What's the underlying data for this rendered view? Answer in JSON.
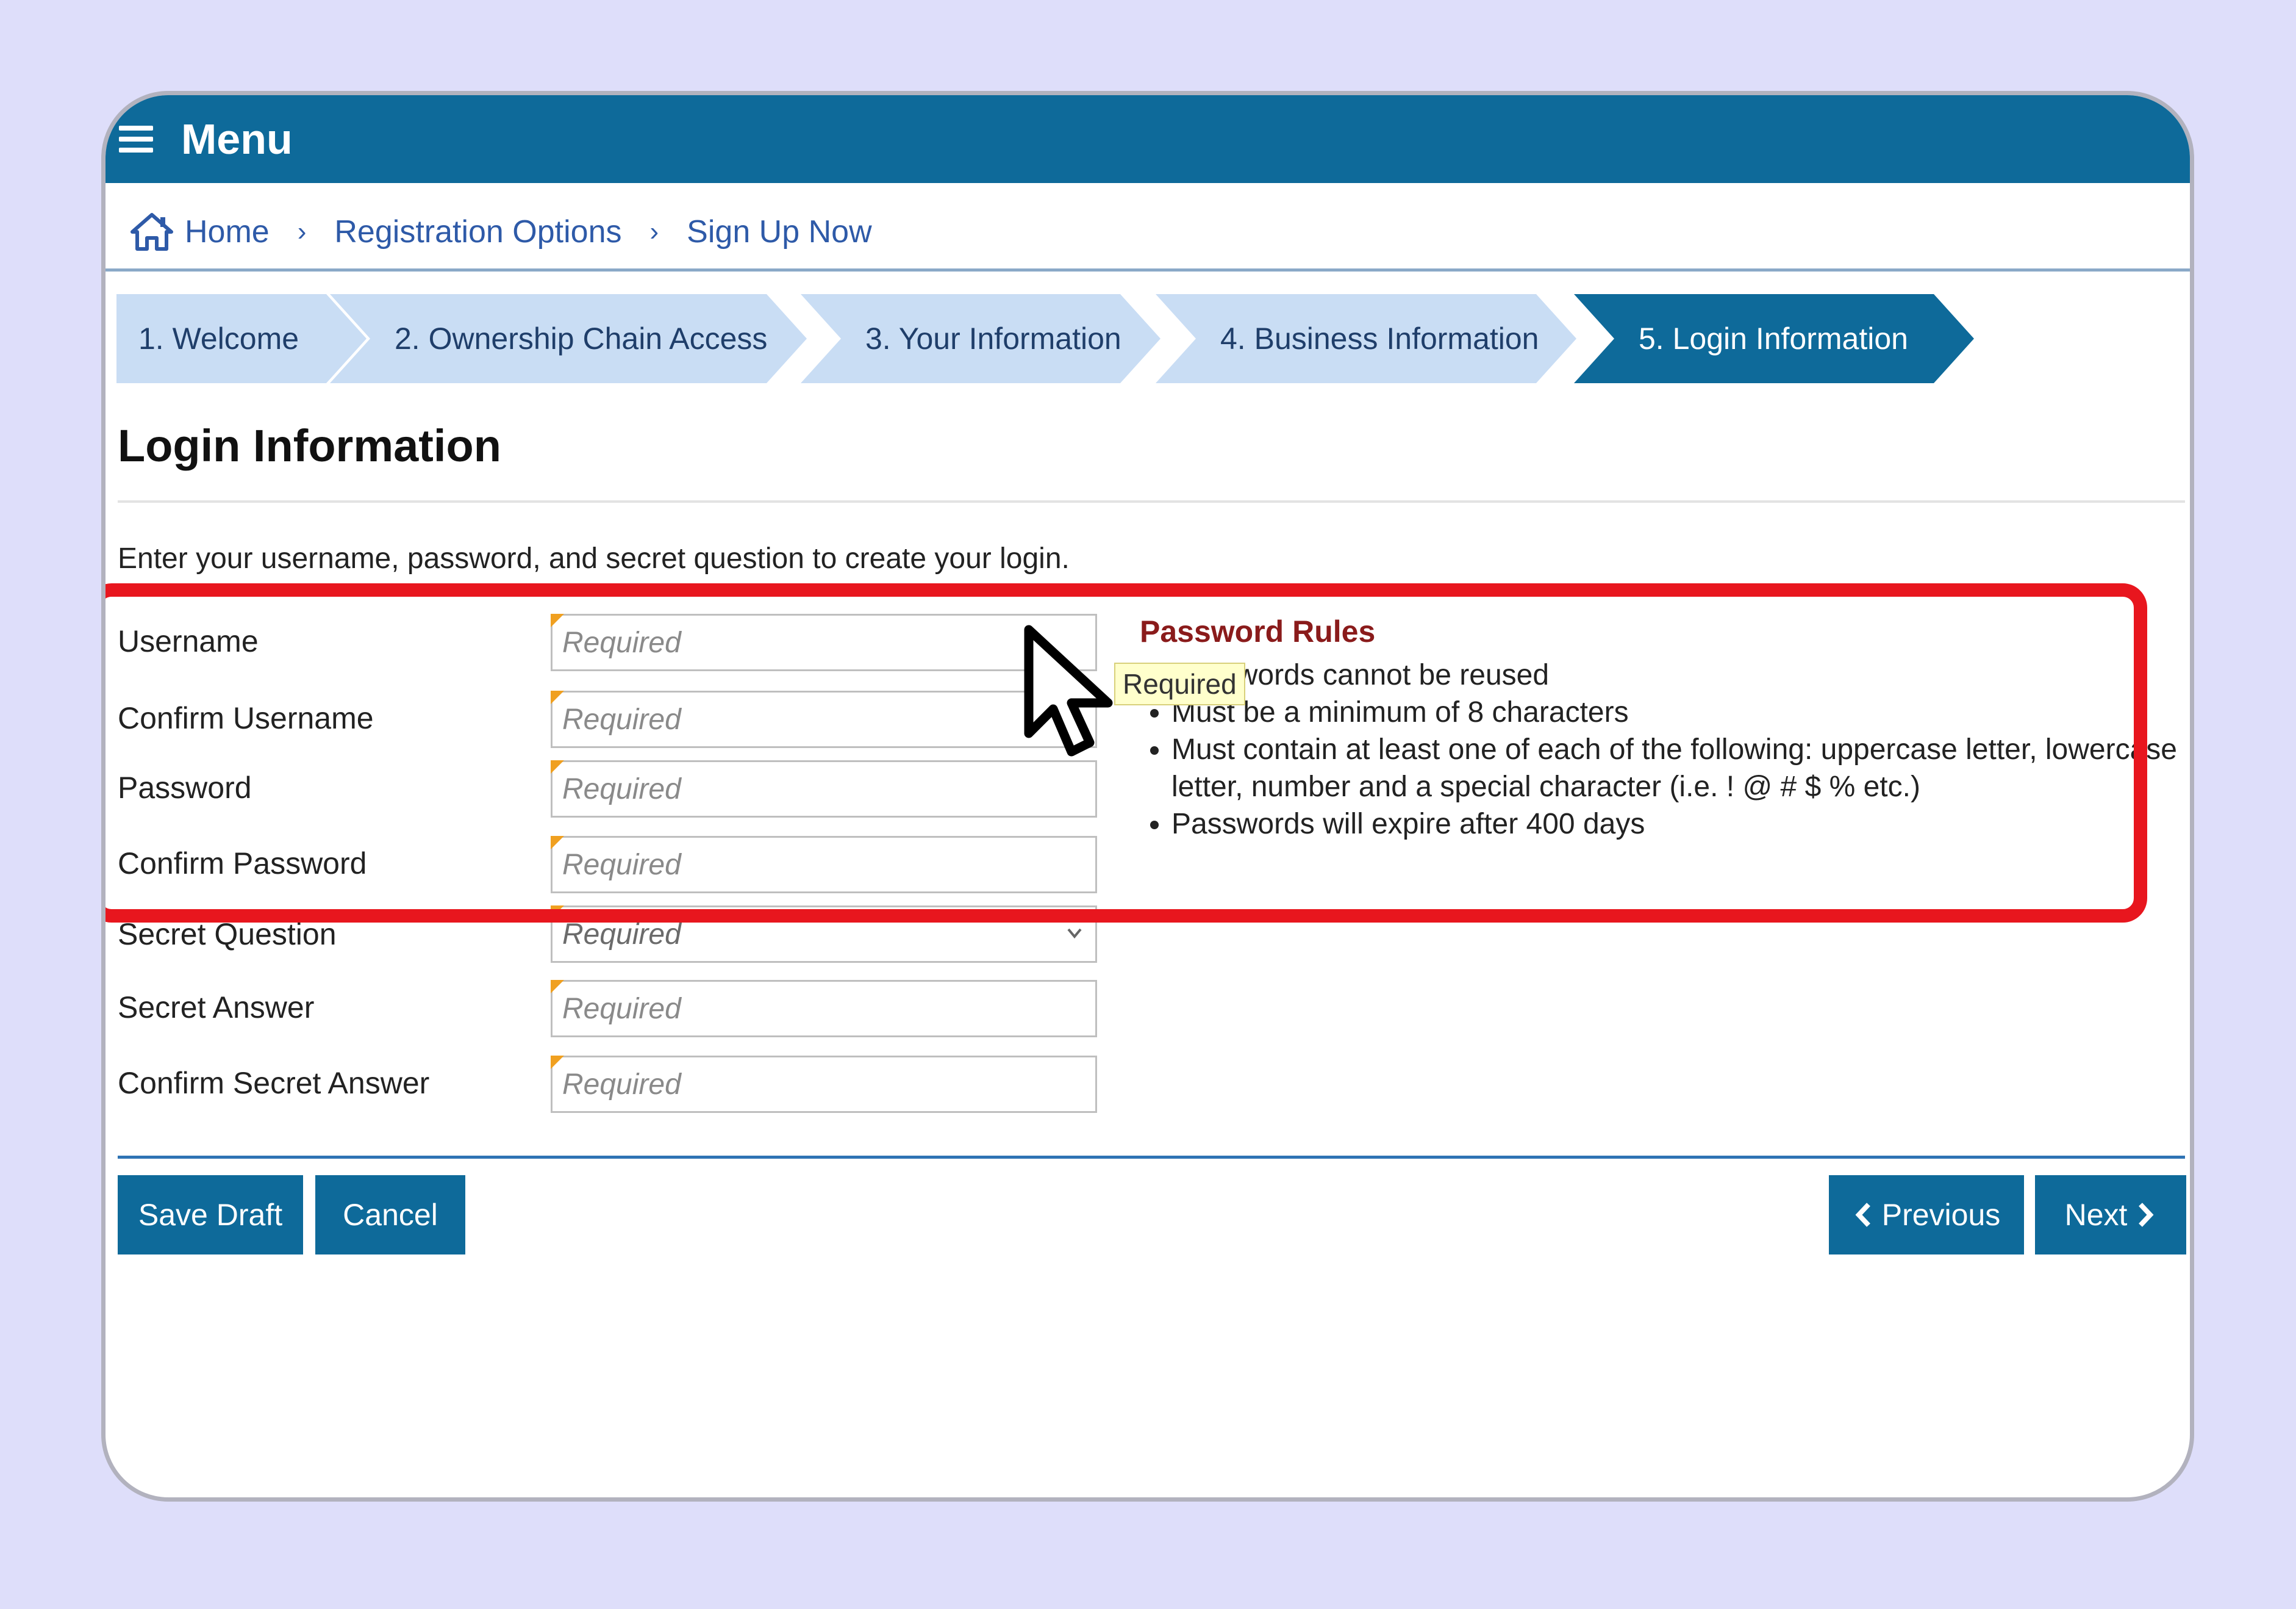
{
  "menu": {
    "title": "Menu"
  },
  "breadcrumb": {
    "items": [
      "Home",
      "Registration Options",
      "Sign Up Now"
    ],
    "separator": "›"
  },
  "steps": [
    {
      "label": "1. Welcome"
    },
    {
      "label": "2. Ownership Chain Access"
    },
    {
      "label": "3. Your Information"
    },
    {
      "label": "4. Business Information"
    },
    {
      "label": "5. Login Information",
      "active": true
    }
  ],
  "page": {
    "title": "Login Information",
    "intro": "Enter your username, password, and secret question to create your login."
  },
  "fields": [
    {
      "label": "Username",
      "placeholder": "Required"
    },
    {
      "label": "Confirm Username",
      "placeholder": "Required"
    },
    {
      "label": "Password",
      "placeholder": "Required"
    },
    {
      "label": "Confirm Password",
      "placeholder": "Required"
    },
    {
      "label": "Secret Question",
      "placeholder": "Required"
    },
    {
      "label": "Secret Answer",
      "placeholder": "Required"
    },
    {
      "label": "Confirm Secret Answer",
      "placeholder": "Required"
    }
  ],
  "password_rules": {
    "title": "Password Rules",
    "items": [
      "Passwords cannot be reused",
      "Must be a minimum of 8 characters",
      "Must contain at least one of each of the following: uppercase letter, lowercase letter, number and a special character (i.e. ! @ # $ % etc.)",
      "Passwords will expire after 400 days"
    ]
  },
  "tooltip": {
    "text": "Required"
  },
  "buttons": {
    "save_draft": "Save Draft",
    "cancel": "Cancel",
    "previous": "Previous",
    "next": "Next"
  },
  "colors": {
    "brand": "#0e6a9a",
    "step_inactive": "#c9ddf4",
    "highlight": "#e8161e",
    "rules_title": "#8a1b1b",
    "link": "#2e5aa8"
  },
  "icons": [
    "menu-icon",
    "home-icon",
    "chevron-down-icon",
    "chevron-left-icon",
    "chevron-right-icon",
    "mouse-cursor-icon"
  ]
}
